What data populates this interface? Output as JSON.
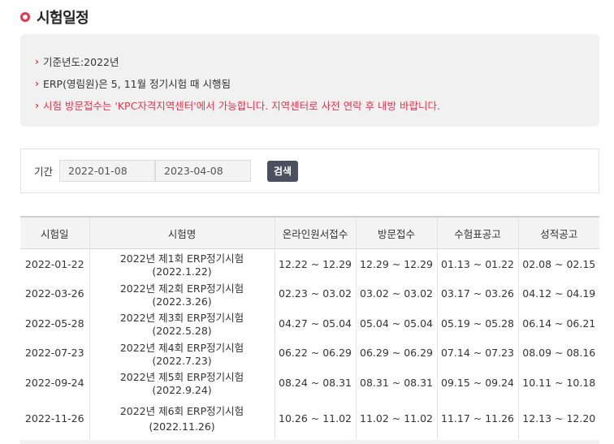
{
  "page_title": "시험일정",
  "notice": {
    "lines": [
      {
        "text": "기준년도:2022년",
        "highlight": false
      },
      {
        "text": "ERP(영림원)은 5, 11월 정기시험 때 시행됨",
        "highlight": false
      },
      {
        "text": "시험 방문접수는 'KPC자격지역센터'에서 가능합니다. 지역센터로 사전 연락 후 내방 바랍니다.",
        "highlight": true
      }
    ],
    "arrow": "›"
  },
  "search": {
    "label": "기간",
    "start_date": "2022-01-08",
    "end_date": "2023-04-08",
    "button_label": "검색"
  },
  "table": {
    "headers": [
      "시험일",
      "시험명",
      "온라인원서접수",
      "방문접수",
      "수험표공고",
      "성적공고"
    ],
    "rows": [
      {
        "date": "2022-01-22",
        "name": "2022년 제1회 ERP정기시험(2022.1.22)",
        "name_line2": "",
        "online": "12.22 ~ 12.29",
        "visit": "12.29 ~ 12.29",
        "ticket": "01.13 ~ 01.22",
        "result": "02.08 ~ 02.15"
      },
      {
        "date": "2022-03-26",
        "name": "2022년 제2회 ERP정기시험(2022.3.26)",
        "name_line2": "",
        "online": "02.23 ~ 03.02",
        "visit": "03.02 ~ 03.02",
        "ticket": "03.17 ~ 03.26",
        "result": "04.12 ~ 04.19"
      },
      {
        "date": "2022-05-28",
        "name": "2022년 제3회 ERP정기시험(2022.5.28)",
        "name_line2": "",
        "online": "04.27 ~ 05.04",
        "visit": "05.04 ~ 05.04",
        "ticket": "05.19 ~ 05.28",
        "result": "06.14 ~ 06.21"
      },
      {
        "date": "2022-07-23",
        "name": "2022년 제4회 ERP정기시험(2022.7.23)",
        "name_line2": "",
        "online": "06.22 ~ 06.29",
        "visit": "06.29 ~ 06.29",
        "ticket": "07.14 ~ 07.23",
        "result": "08.09 ~ 08.16"
      },
      {
        "date": "2022-09-24",
        "name": "2022년 제5회 ERP정기시험(2022.9.24)",
        "name_line2": "",
        "online": "08.24 ~ 08.31",
        "visit": "08.31 ~ 08.31",
        "ticket": "09.15 ~ 09.24",
        "result": "10.11 ~ 10.18"
      },
      {
        "date": "2022-11-26",
        "name": "2022년 제6회 ERP정기시험",
        "name_line2": "(2022.11.26)",
        "online": "10.26 ~ 11.02",
        "visit": "11.02 ~ 11.02",
        "ticket": "11.17 ~ 11.26",
        "result": "12.13 ~ 12.20"
      }
    ]
  },
  "colors": {
    "accent": "#e8344e",
    "button": "#4a5060",
    "notice_bg": "#f1f1f1"
  }
}
